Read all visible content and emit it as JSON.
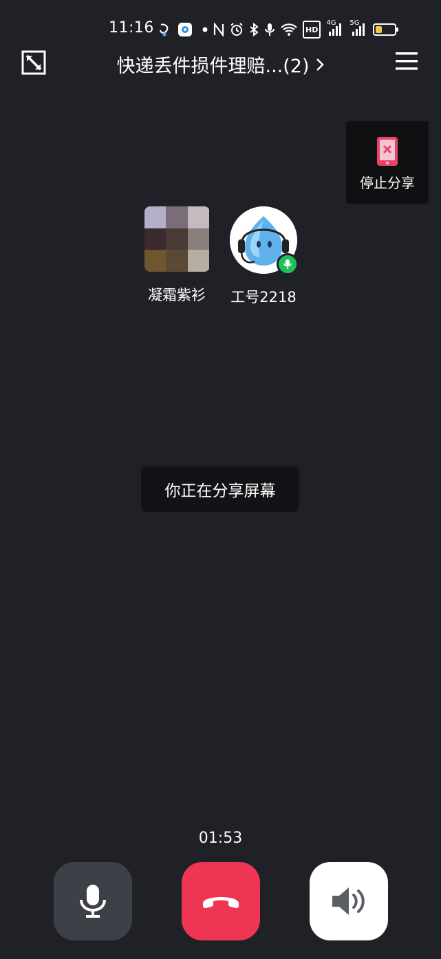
{
  "status_bar": {
    "time": "11:16",
    "network_4g": "4G",
    "network_5g": "5G",
    "hd_label": "HD",
    "icons": [
      "assistant-icon",
      "app-icon",
      "dot-icon",
      "nfc-icon",
      "alarm-icon",
      "bluetooth-icon",
      "mic-status-icon",
      "wifi-icon",
      "hd-icon",
      "signal-4g-icon",
      "signal-5g-icon",
      "battery-icon"
    ],
    "battery_level": 0.35,
    "battery_color": "#f0c74a"
  },
  "header": {
    "title": "快递丢件损件理赔...(2)",
    "minimize_icon": "shrink-window-icon",
    "menu_icon": "hamburger-menu-icon"
  },
  "stop_share": {
    "label": "停止分享",
    "icon": "stop-share-phone-icon",
    "accent": "#e8436a"
  },
  "participants": [
    {
      "name": "凝霜紫衫",
      "avatar": "pixelated-photo"
    },
    {
      "name": "工号2218",
      "avatar": "agent-mascot",
      "speaking": true
    }
  ],
  "toast": {
    "text": "你正在分享屏幕"
  },
  "call": {
    "duration": "01:53",
    "controls": [
      {
        "name": "microphone",
        "icon": "microphone-icon",
        "color": "#3e4047"
      },
      {
        "name": "hang-up",
        "icon": "phone-hangup-icon",
        "color": "#ee3554"
      },
      {
        "name": "speaker",
        "icon": "speaker-icon",
        "color": "#ffffff"
      }
    ]
  },
  "colors": {
    "background": "#1f2126",
    "speaking_green": "#1fc25a"
  }
}
